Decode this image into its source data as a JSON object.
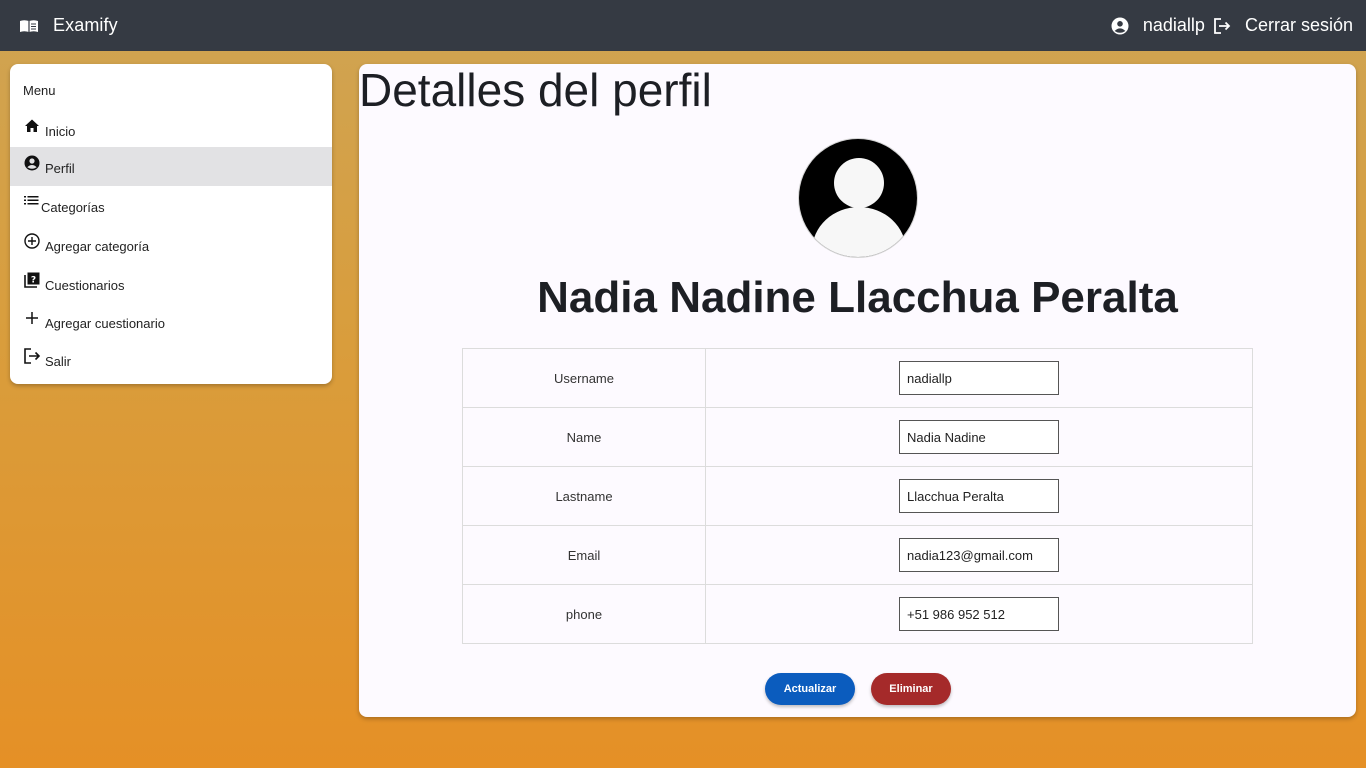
{
  "app": {
    "brand": "Examify",
    "username": "nadiallp",
    "logout_label": "Cerrar sesión"
  },
  "sidebar": {
    "heading": "Menu",
    "items": [
      {
        "label": "Inicio",
        "icon": "home-icon"
      },
      {
        "label": "Perfil",
        "icon": "account-circle-icon",
        "active": true
      },
      {
        "label": "Categorías",
        "icon": "list-icon"
      },
      {
        "label": "Agregar categoría",
        "icon": "add-circle-icon"
      },
      {
        "label": "Cuestionarios",
        "icon": "quiz-icon"
      },
      {
        "label": "Agregar cuestionario",
        "icon": "plus-icon"
      },
      {
        "label": "Salir",
        "icon": "logout-icon"
      }
    ]
  },
  "profile": {
    "page_title": "Detalles del perfil",
    "full_name": "Nadia Nadine Llacchua Peralta",
    "fields": [
      {
        "label": "Username",
        "value": "nadiallp"
      },
      {
        "label": "Name",
        "value": "Nadia Nadine"
      },
      {
        "label": "Lastname",
        "value": "Llacchua Peralta"
      },
      {
        "label": "Email",
        "value": "nadia123@gmail.com"
      },
      {
        "label": "phone",
        "value": "+51 986 952 512"
      }
    ],
    "update_label": "Actualizar",
    "delete_label": "Eliminar"
  },
  "colors": {
    "topbar": "#353a43",
    "update_button": "#0b5cbe",
    "delete_button": "#a52a2a",
    "active_menu": "#e2e2e4"
  }
}
